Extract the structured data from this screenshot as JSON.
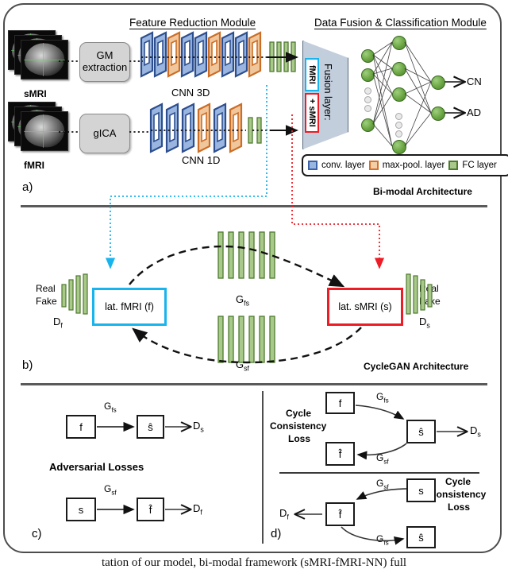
{
  "figure": {
    "caption_partial": "tation of our model, bi-modal framework (sMRI-fMRI-NN) full"
  },
  "panel_a": {
    "letter": "a)",
    "headers": {
      "feature_reduction": "Feature Reduction Module",
      "data_fusion": "Data Fusion & Classification Module"
    },
    "title": "Bi-modal Architecture",
    "inputs": [
      {
        "label": "sMRI",
        "process": "GM\nextraction",
        "process_line1": "GM",
        "process_line2": "extraction",
        "cnn": "CNN 3D"
      },
      {
        "label": "fMRI",
        "process": "gICA",
        "process_line1": "gICA",
        "process_line2": "",
        "cnn": "CNN 1D"
      }
    ],
    "cnn3d_layers": [
      "conv",
      "conv",
      "pool",
      "conv",
      "conv",
      "pool",
      "conv",
      "conv",
      "pool"
    ],
    "cnn3d_fc_count": 4,
    "cnn1d_layers": [
      "conv",
      "conv",
      "conv",
      "pool",
      "conv",
      "pool"
    ],
    "cnn1d_fc_count": 2,
    "fusion": {
      "label": "Fusion layer:",
      "tag_top": "fMRI",
      "tag_bottom": "+ sMRI",
      "tag_top_color": "#18b4ee",
      "tag_bottom_color": "#ee1c25"
    },
    "outputs": [
      "CN",
      "AD"
    ],
    "legend": [
      {
        "name": "conv. layer",
        "color": "#3b62a8"
      },
      {
        "name": "max-pool. layer",
        "color": "#d4722a"
      },
      {
        "name": "FC layer",
        "color": "#4d7a2e"
      }
    ]
  },
  "panel_b": {
    "letter": "b)",
    "title": "CycleGAN Architecture",
    "latent_f": "lat. fMRI (f)",
    "latent_s": "lat. sMRI (s)",
    "generator_fs": "G",
    "generator_fs_sub": "fs",
    "generator_sf": "G",
    "generator_sf_sub": "sf",
    "discriminator_f": "D",
    "discriminator_f_sub": "f",
    "discriminator_s": "D",
    "discriminator_s_sub": "s",
    "real": "Real",
    "fake": "Fake",
    "gen_bar_count": 6
  },
  "panel_c": {
    "letter": "c)",
    "title": "Adversarial Losses",
    "rows": [
      {
        "src": "f",
        "gen": "G",
        "gen_sub": "fs",
        "dst": "ŝ",
        "disc": "D",
        "disc_sub": "s"
      },
      {
        "src": "s",
        "gen": "G",
        "gen_sub": "sf",
        "dst": "f̂",
        "disc": "D",
        "disc_sub": "f"
      }
    ]
  },
  "panel_d": {
    "letter": "d)",
    "title_lines": [
      "Cycle",
      "Consistency",
      "Loss"
    ],
    "top": {
      "src": "f",
      "gen_fwd": "G",
      "gen_fwd_sub": "fs",
      "mid": "ŝ",
      "disc": "D",
      "disc_sub": "s",
      "gen_back": "G",
      "gen_back_sub": "sf",
      "back": "f̂"
    },
    "bottom": {
      "src": "s",
      "gen_fwd": "G",
      "gen_fwd_sub": "sf",
      "mid": "f̂",
      "disc": "D",
      "disc_sub": "f",
      "gen_back": "G",
      "gen_back_sub": "fs",
      "back": "ŝ"
    }
  }
}
